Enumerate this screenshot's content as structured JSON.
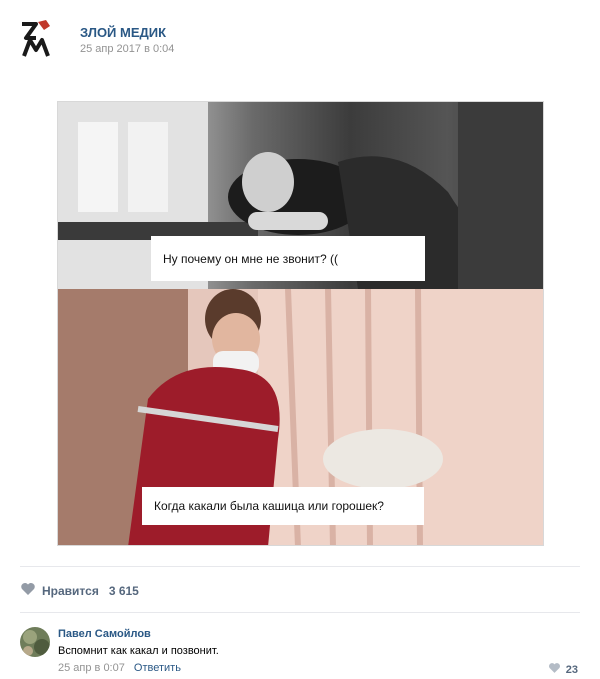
{
  "post": {
    "group_name": "ЗЛОЙ МЕДИК",
    "date": "25 апр 2017 в 0:04",
    "logo_text": "ЗМ"
  },
  "meme": {
    "caption_top": "Ну почему он мне не звонит? ((",
    "caption_bottom": "Когда какали была кашица или горошек?"
  },
  "likes": {
    "label": "Нравится",
    "count": "3 615",
    "icon": "heart-icon"
  },
  "comment": {
    "author": "Павел Самойлов",
    "text": "Вспомнит как какал и позвонит.",
    "date": "25 апр в 0:07",
    "reply_label": "Ответить",
    "likes": "23"
  },
  "colors": {
    "link": "#2a5885",
    "muted": "#939393",
    "accent_red": "#c0392b"
  }
}
